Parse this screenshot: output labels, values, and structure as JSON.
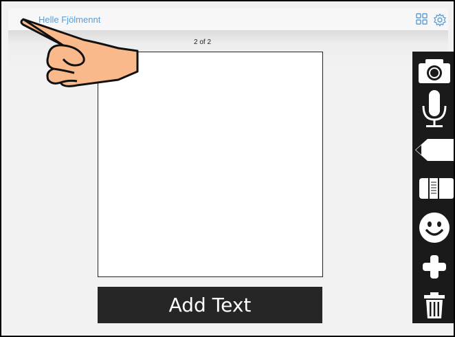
{
  "header": {
    "title": "Helle Fjölmennt",
    "icons": [
      "grid-icon",
      "settings-gear-icon"
    ],
    "accent_color": "#5b9bd5"
  },
  "page_indicator": "2 of 2",
  "add_text_button": {
    "label": "Add Text"
  },
  "toolbar": {
    "tools": [
      "camera-icon",
      "microphone-icon",
      "pencil-icon",
      "eraser-icon",
      "sticker-face-icon",
      "add-icon",
      "trash-icon"
    ]
  },
  "overlay": {
    "icon": "pointing-hand-icon"
  }
}
